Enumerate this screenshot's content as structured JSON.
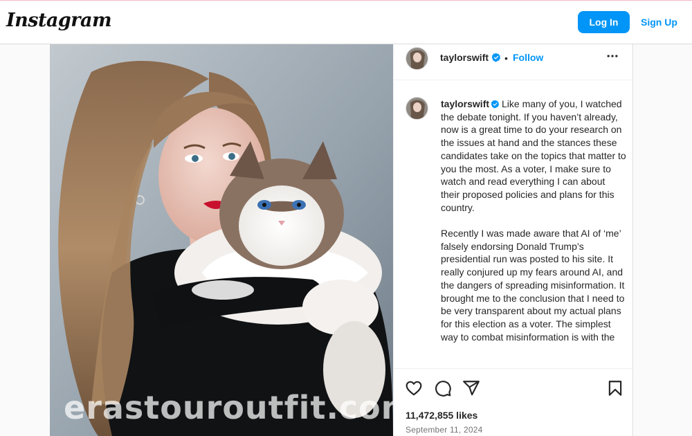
{
  "app": {
    "name": "Instagram"
  },
  "header": {
    "login_label": "Log In",
    "signup_label": "Sign Up"
  },
  "post": {
    "author": "taylorswift",
    "verified": true,
    "follow_label": "Follow",
    "dot": "•",
    "caption_paragraphs": [
      "Like many of you, I watched the debate tonight. If you haven’t already, now is a great time to do your research on the issues at hand and the stances these candidates take on the topics that matter to you the most. As a voter, I make sure to watch and read everything I can about their proposed policies and plans for this country.",
      "Recently I was made aware that AI of ‘me’ falsely endorsing Donald Trump’s presidential run was posted to his site. It really conjured up my fears around AI, and the dangers of spreading misinformation. It brought me to the conclusion that I need to be very transparent about my actual plans for this election as a voter. The simplest way to combat misinformation is with the"
    ],
    "likes": "11,472,855 likes",
    "date": "September 11, 2024",
    "watermark": "erastouroutfit.com"
  },
  "icons": {
    "verified": "verified-badge-icon",
    "more": "more-options-icon",
    "like": "heart-icon",
    "comment": "comment-icon",
    "share": "share-icon",
    "save": "bookmark-icon"
  },
  "colors": {
    "brand_blue": "#0095f6",
    "text": "#262626",
    "muted": "#737373",
    "border": "#dbdbdb"
  }
}
